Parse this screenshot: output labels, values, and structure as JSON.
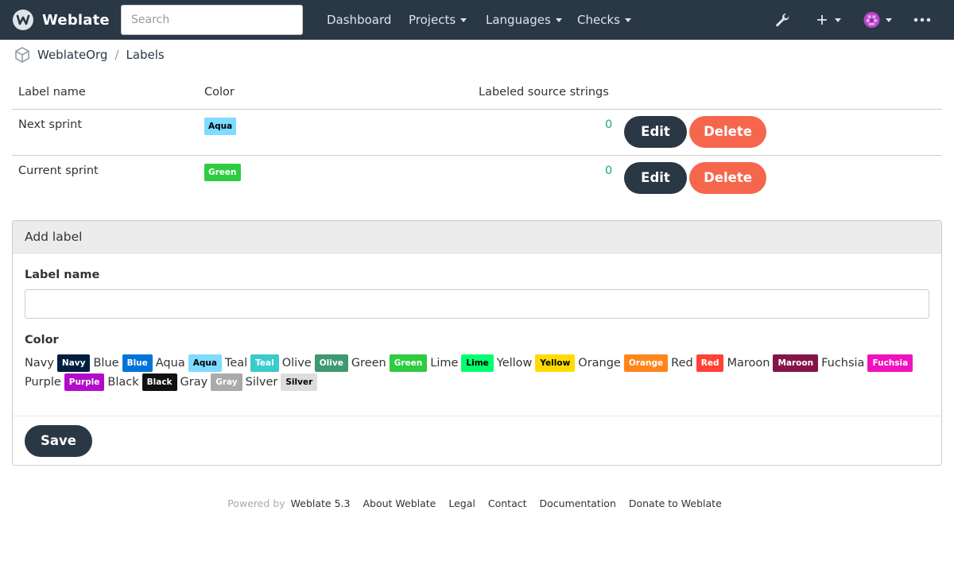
{
  "navbar": {
    "brand": "Weblate",
    "search_placeholder": "Search",
    "items": [
      {
        "label": "Dashboard",
        "dropdown": false
      },
      {
        "label": "Projects",
        "dropdown": true
      },
      {
        "label": "Languages",
        "dropdown": true
      },
      {
        "label": "Checks",
        "dropdown": true
      }
    ],
    "icons": [
      "wrench-icon",
      "plus-icon",
      "avatar",
      "more-icon"
    ]
  },
  "breadcrumb": {
    "items": [
      "WeblateOrg",
      "Labels"
    ]
  },
  "table": {
    "headers": [
      "Label name",
      "Color",
      "Labeled source strings"
    ],
    "rows": [
      {
        "name": "Next sprint",
        "color": "Aqua",
        "color_bg": "#7fdbff",
        "color_fg": "#000000",
        "count": "0",
        "edit": "Edit",
        "delete": "Delete"
      },
      {
        "name": "Current sprint",
        "color": "Green",
        "color_bg": "#2ecc40",
        "color_fg": "#ffffff",
        "count": "0",
        "edit": "Edit",
        "delete": "Delete"
      }
    ]
  },
  "add_label": {
    "heading": "Add label",
    "label_name": "Label name",
    "label_name_value": "",
    "color_label": "Color",
    "colors": [
      {
        "name": "Navy",
        "badge": "Navy",
        "bg": "#001f3f",
        "fg": "#ffffff"
      },
      {
        "name": "Blue",
        "badge": "Blue",
        "bg": "#0074d9",
        "fg": "#ffffff"
      },
      {
        "name": "Aqua",
        "badge": "Aqua",
        "bg": "#7fdbff",
        "fg": "#000000"
      },
      {
        "name": "Teal",
        "badge": "Teal",
        "bg": "#39cccc",
        "fg": "#ffffff"
      },
      {
        "name": "Olive",
        "badge": "Olive",
        "bg": "#3d9970",
        "fg": "#ffffff"
      },
      {
        "name": "Green",
        "badge": "Green",
        "bg": "#2ecc40",
        "fg": "#ffffff"
      },
      {
        "name": "Lime",
        "badge": "Lime",
        "bg": "#01ff70",
        "fg": "#000000"
      },
      {
        "name": "Yellow",
        "badge": "Yellow",
        "bg": "#ffdc00",
        "fg": "#000000"
      },
      {
        "name": "Orange",
        "badge": "Orange",
        "bg": "#ff851b",
        "fg": "#ffffff"
      },
      {
        "name": "Red",
        "badge": "Red",
        "bg": "#ff4136",
        "fg": "#ffffff"
      },
      {
        "name": "Maroon",
        "badge": "Maroon",
        "bg": "#85144b",
        "fg": "#ffffff"
      },
      {
        "name": "Fuchsia",
        "badge": "Fuchsia",
        "bg": "#f012be",
        "fg": "#ffffff"
      },
      {
        "name": "Purple",
        "badge": "Purple",
        "bg": "#b10dc9",
        "fg": "#ffffff"
      },
      {
        "name": "Black",
        "badge": "Black",
        "bg": "#111111",
        "fg": "#ffffff"
      },
      {
        "name": "Gray",
        "badge": "Gray",
        "bg": "#aaaaaa",
        "fg": "#ffffff"
      },
      {
        "name": "Silver",
        "badge": "Silver",
        "bg": "#dddddd",
        "fg": "#000000"
      }
    ],
    "save": "Save"
  },
  "footer": {
    "powered_by": "Powered by",
    "version_link": "Weblate 5.3",
    "links": [
      "About Weblate",
      "Legal",
      "Contact",
      "Documentation",
      "Donate to Weblate"
    ]
  },
  "theme": {
    "navbar_bg": "#2a3744",
    "primary": "#2a3744",
    "danger": "#f6664c",
    "count_color": "#1fa385"
  }
}
